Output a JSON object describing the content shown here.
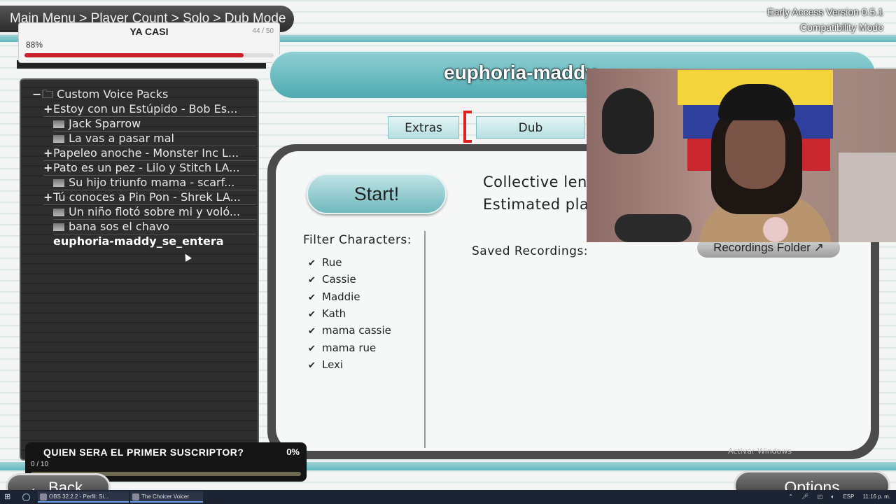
{
  "breadcrumb": "Main Menu > Player Count > Solo > Dub Mode",
  "version": {
    "line1": "Early Access Version 0.5.1",
    "line2": "Compatibility Mode"
  },
  "goal_top": {
    "title": "YA CASI",
    "count": "44 / 50",
    "percent": "88%",
    "progress": 0.88
  },
  "tree": {
    "root": "Custom Voice Packs",
    "items": [
      {
        "marker": "+",
        "label": "Estoy con un Estúpido - Bob Es..."
      },
      {
        "marker": "",
        "label": "Jack Sparrow"
      },
      {
        "marker": "",
        "label": "La vas a pasar mal"
      },
      {
        "marker": "+",
        "label": "Papeleo anoche - Monster Inc L..."
      },
      {
        "marker": "+",
        "label": "Pato es un pez - Lilo y Stitch LA..."
      },
      {
        "marker": "",
        "label": "Su hijo triunfo mama - scarf..."
      },
      {
        "marker": "+",
        "label": "Tú conoces a Pin Pon - Shrek LA..."
      },
      {
        "marker": "",
        "label": "Un niño flotó sobre mi y voló..."
      },
      {
        "marker": "",
        "label": "bana sos el chavo"
      }
    ],
    "selected": "euphoria-maddy_se_entera"
  },
  "header": {
    "title": "euphoria-maddy"
  },
  "tabs": {
    "extras": "Extras",
    "dub": "Dub"
  },
  "main": {
    "start_label": "Start!",
    "info1": "Collective len",
    "info2": "Estimated pla",
    "filter_title": "Filter Characters:",
    "filters": [
      "Rue",
      "Cassie",
      "Maddie",
      "Kath",
      "mama cassie",
      "mama rue",
      "Lexi"
    ],
    "saved_label": "Saved Recordings:",
    "recordings_folder": "Recordings Folder ↗",
    "watermark": "Activar Windows"
  },
  "goal_bottom": {
    "title": "QUIEN SERA EL PRIMER SUSCRIPTOR?",
    "percent": "0%",
    "count": "0 / 10",
    "progress": 0.0
  },
  "buttons": {
    "back": "Back",
    "options": "Options"
  },
  "taskbar": {
    "app1": "OBS 32.2.2 - Perfil: Si...",
    "app2": "The Choicer Voicer",
    "lang": "ESP",
    "time": "11:16 p. m."
  },
  "colors": {
    "accent_teal": "#5fb8bd",
    "progress_red": "#c7202a",
    "goal_yellow": "#d4c14a"
  }
}
